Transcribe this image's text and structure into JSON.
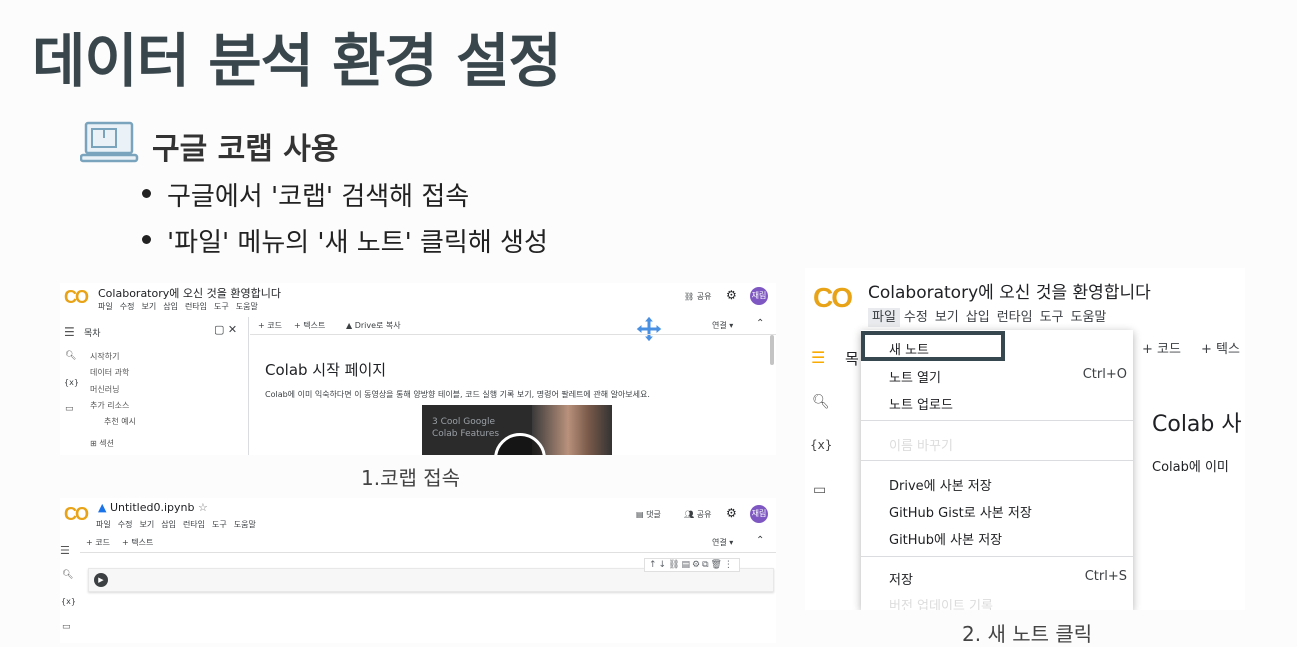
{
  "slide": {
    "title": "데이터 분석 환경 설정",
    "subtitle": "구글 코랩 사용",
    "bullets": [
      "구글에서 '코랩' 검색해 접속",
      "'파일' 메뉴의 '새 노트' 클릭해 생성"
    ],
    "caption1": "1.코랩 접속",
    "caption2": "2. 새 노트 클릭"
  },
  "shot1": {
    "logo": "CO",
    "title": "Colaboratory에 오신 것을 환영합니다",
    "menu": [
      "파일",
      "수정",
      "보기",
      "삽입",
      "런타임",
      "도구",
      "도움말"
    ],
    "share": "공유",
    "avatar": "재림",
    "toc_title": "목차",
    "toc_items": [
      "시작하기",
      "데이터 과학",
      "머신러닝",
      "추가 리소스",
      "추천 예시"
    ],
    "toc_section": "섹션",
    "add_code": "+ 코드",
    "add_text": "+ 텍스트",
    "drive_copy": "Drive로 복사",
    "connect": "연결",
    "page_heading": "Colab 시작 페이지",
    "page_body": "Colab에 이미 익숙하다면 이 동영상을 통해 양방향 테이블, 코드 실행 기록 보기, 명령어 팔레트에 관해 알아보세요.",
    "video_text_1": "3 Cool Google",
    "video_text_2": "Colab Features"
  },
  "shot1b": {
    "logo": "CO",
    "filename": "Untitled0.ipynb",
    "menu": [
      "파일",
      "수정",
      "보기",
      "삽입",
      "런타임",
      "도구",
      "도움말"
    ],
    "comment": "댓글",
    "share": "공유",
    "avatar": "재림",
    "add_code": "+ 코드",
    "add_text": "+ 텍스트",
    "connect": "연결"
  },
  "shot2": {
    "logo": "CO",
    "title": "Colaboratory에 오신 것을 환영합니다",
    "menu": [
      "파일",
      "수정",
      "보기",
      "삽입",
      "런타임",
      "도구",
      "도움말"
    ],
    "toc_partial": "목",
    "add_code": "+ 코드",
    "add_text_partial": "+ 텍스",
    "page_heading_partial": "Colab 사",
    "page_body_partial": "Colab에 이미",
    "dropdown": [
      {
        "label": "새 노트",
        "shortcut": ""
      },
      {
        "label": "노트 열기",
        "shortcut": "Ctrl+O"
      },
      {
        "label": "노트 업로드",
        "shortcut": ""
      },
      {
        "label": "이름 바꾸기",
        "shortcut": ""
      },
      {
        "label": "Drive에 사본 저장",
        "shortcut": ""
      },
      {
        "label": "GitHub Gist로 사본 저장",
        "shortcut": ""
      },
      {
        "label": "GitHub에 사본 저장",
        "shortcut": ""
      },
      {
        "label": "저장",
        "shortcut": "Ctrl+S"
      },
      {
        "label": "버전 업데이트 기록",
        "shortcut": ""
      }
    ]
  },
  "colors": {
    "accent_orange": "#f9ab00",
    "highlight_box": "#37474f",
    "move_icon": "#4a90e2"
  }
}
